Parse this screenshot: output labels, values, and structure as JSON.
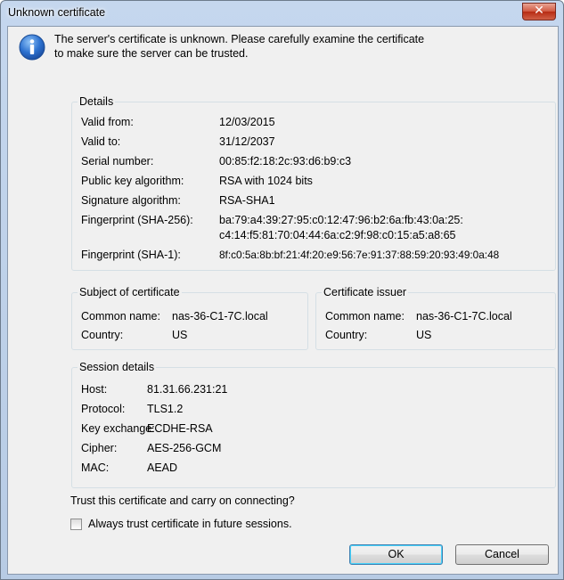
{
  "window": {
    "title": "Unknown certificate",
    "close_symbol": "✕"
  },
  "intro": {
    "line1": "The server's certificate is unknown. Please carefully examine the certificate",
    "line2": "to make sure the server can be trusted."
  },
  "details": {
    "title": "Details",
    "valid_from_label": "Valid from:",
    "valid_from": "12/03/2015",
    "valid_to_label": "Valid to:",
    "valid_to": "31/12/2037",
    "serial_label": "Serial number:",
    "serial": "00:85:f2:18:2c:93:d6:b9:c3",
    "pubkey_label": "Public key algorithm:",
    "pubkey": "RSA with 1024 bits",
    "sigalg_label": "Signature algorithm:",
    "sigalg": "RSA-SHA1",
    "fp256_label": "Fingerprint (SHA-256):",
    "fp256_line1": "ba:79:a4:39:27:95:c0:12:47:96:b2:6a:fb:43:0a:25:",
    "fp256_line2": "c4:14:f5:81:70:04:44:6a:c2:9f:98:c0:15:a5:a8:65",
    "fp1_label": "Fingerprint (SHA-1):",
    "fp1": "8f:c0:5a:8b:bf:21:4f:20:e9:56:7e:91:37:88:59:20:93:49:0a:48"
  },
  "subject": {
    "title": "Subject of certificate",
    "cn_label": "Common name:",
    "cn": "nas-36-C1-7C.local",
    "country_label": "Country:",
    "country": "US"
  },
  "issuer": {
    "title": "Certificate issuer",
    "cn_label": "Common name:",
    "cn": "nas-36-C1-7C.local",
    "country_label": "Country:",
    "country": "US"
  },
  "session": {
    "title": "Session details",
    "host_label": "Host:",
    "host": "81.31.66.231:21",
    "protocol_label": "Protocol:",
    "protocol": "TLS1.2",
    "kex_label": "Key exchange:",
    "kex": "ECDHE-RSA",
    "cipher_label": "Cipher:",
    "cipher": "AES-256-GCM",
    "mac_label": "MAC:",
    "mac": "AEAD"
  },
  "prompt": "Trust this certificate and carry on connecting?",
  "always_trust": {
    "label": "Always trust certificate in future sessions.",
    "checked": false
  },
  "buttons": {
    "ok": "OK",
    "cancel": "Cancel"
  },
  "icons": {
    "info": "info-icon",
    "close": "close-icon"
  }
}
